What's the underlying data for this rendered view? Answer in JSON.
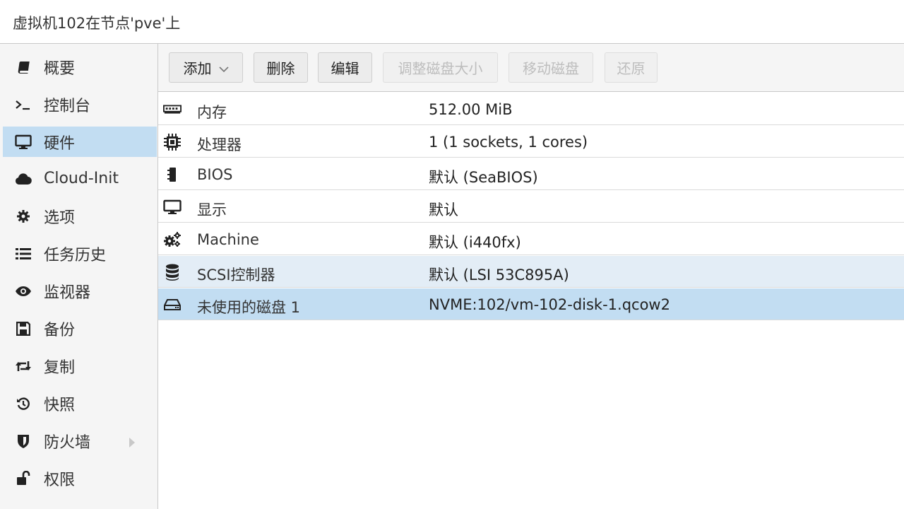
{
  "window": {
    "title": "虚拟机102在节点'pve'上"
  },
  "sidebar": {
    "items": [
      {
        "label": "概要",
        "icon": "book-icon"
      },
      {
        "label": "控制台",
        "icon": "terminal-icon"
      },
      {
        "label": "硬件",
        "icon": "desktop-icon",
        "selected": true
      },
      {
        "label": "Cloud-Init",
        "icon": "cloud-icon"
      },
      {
        "label": "选项",
        "icon": "gear-icon"
      },
      {
        "label": "任务历史",
        "icon": "list-icon"
      },
      {
        "label": "监视器",
        "icon": "eye-icon"
      },
      {
        "label": "备份",
        "icon": "floppy-icon"
      },
      {
        "label": "复制",
        "icon": "retweet-icon"
      },
      {
        "label": "快照",
        "icon": "history-icon"
      },
      {
        "label": "防火墙",
        "icon": "shield-icon",
        "expandable": true
      },
      {
        "label": "权限",
        "icon": "unlock-icon"
      }
    ]
  },
  "toolbar": {
    "add": "添加",
    "remove": "删除",
    "edit": "编辑",
    "resize": "调整磁盘大小",
    "move": "移动磁盘",
    "revert": "还原"
  },
  "hardware": {
    "rows": [
      {
        "name": "内存",
        "value": "512.00 MiB",
        "icon": "memory-icon"
      },
      {
        "name": "处理器",
        "value": "1 (1 sockets, 1 cores)",
        "icon": "cpu-icon"
      },
      {
        "name": "BIOS",
        "value": "默认 (SeaBIOS)",
        "icon": "microchip-icon"
      },
      {
        "name": "显示",
        "value": "默认",
        "icon": "desktop-icon"
      },
      {
        "name": "Machine",
        "value": "默认 (i440fx)",
        "icon": "cogs-icon"
      },
      {
        "name": "SCSI控制器",
        "value": "默认 (LSI 53C895A)",
        "icon": "database-icon"
      },
      {
        "name": "未使用的磁盘 1",
        "value": "NVME:102/vm-102-disk-1.qcow2",
        "icon": "hdd-icon"
      }
    ]
  }
}
